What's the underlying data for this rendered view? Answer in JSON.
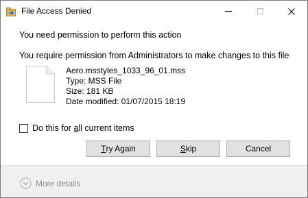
{
  "window": {
    "title": "File Access Denied",
    "minimize_icon": "minimize-icon",
    "maximize_icon": "maximize-icon",
    "close_icon": "close-icon"
  },
  "message": {
    "heading": "You need permission to perform this action",
    "subheading": "You require permission from Administrators to make changes to this file"
  },
  "file": {
    "icon": "file-icon",
    "name": "Aero.msstyles_1033_96_01.mss",
    "type": "Type: MSS File",
    "size": "Size: 181 KB",
    "date_modified": "Date modified: 01/07/2015 18:19"
  },
  "checkbox": {
    "label_before": "Do this for ",
    "label_accel": "a",
    "label_after": "ll current items",
    "checked": false
  },
  "buttons": {
    "try_again_before": "",
    "try_again_accel": "T",
    "try_again_after": "ry Again",
    "skip_before": "",
    "skip_accel": "S",
    "skip_after": "kip",
    "cancel": "Cancel"
  },
  "footer": {
    "more_details": "More details",
    "icon": "chevron-down-circle-icon"
  },
  "colors": {
    "accent_folder": "#2a6ebb",
    "button_face": "#e1e1e1",
    "button_border": "#adadad",
    "footer_bg": "#f0f0f0",
    "footer_text": "#8a8a8a"
  }
}
